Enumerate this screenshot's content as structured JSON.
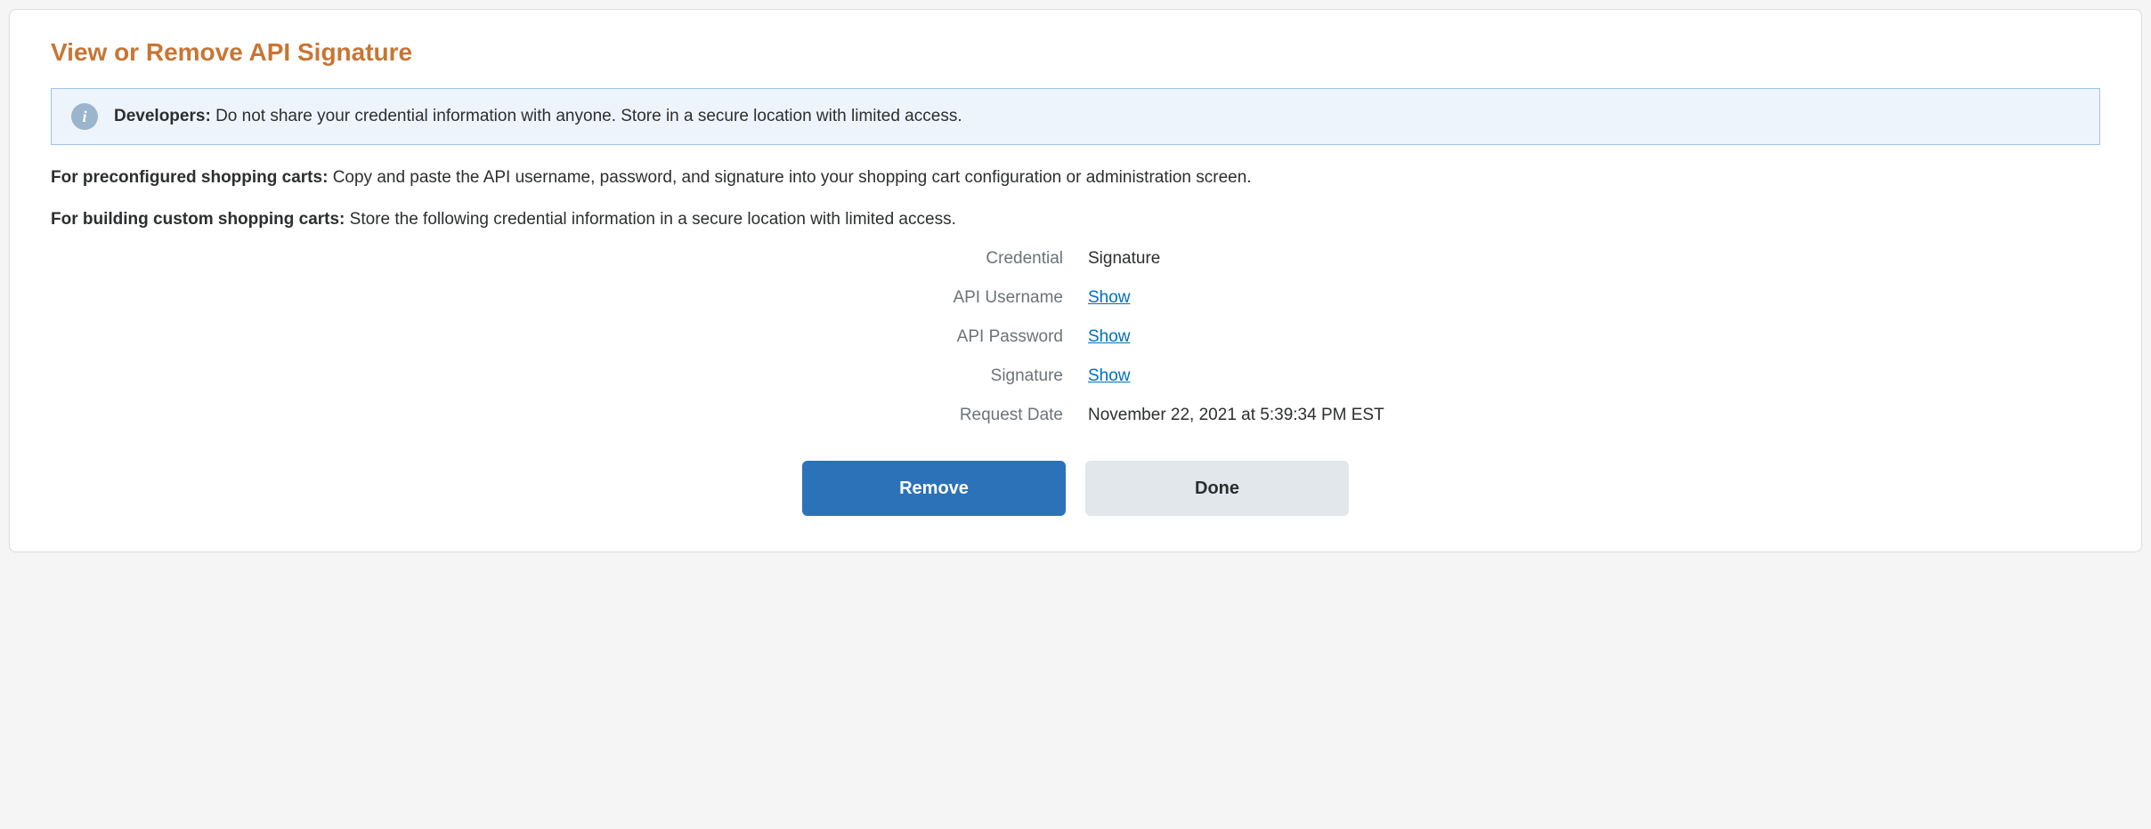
{
  "page": {
    "title": "View or Remove API Signature"
  },
  "banner": {
    "label": "Developers:",
    "text": "Do not share your credential information with anyone. Store in a secure location with limited access."
  },
  "paragraphs": {
    "preconfigured": {
      "label": "For preconfigured shopping carts:",
      "text": "Copy and paste the API username, password, and signature into your shopping cart configuration or administration screen."
    },
    "custom": {
      "label": "For building custom shopping carts:",
      "text": "Store the following credential information in a secure location with limited access."
    }
  },
  "credentials": {
    "credential_label": "Credential",
    "credential_value": "Signature",
    "api_username_label": "API Username",
    "api_username_action": "Show",
    "api_password_label": "API Password",
    "api_password_action": "Show",
    "signature_label": "Signature",
    "signature_action": "Show",
    "request_date_label": "Request Date",
    "request_date_value": "November 22, 2021 at 5:39:34 PM EST"
  },
  "buttons": {
    "remove": "Remove",
    "done": "Done"
  }
}
